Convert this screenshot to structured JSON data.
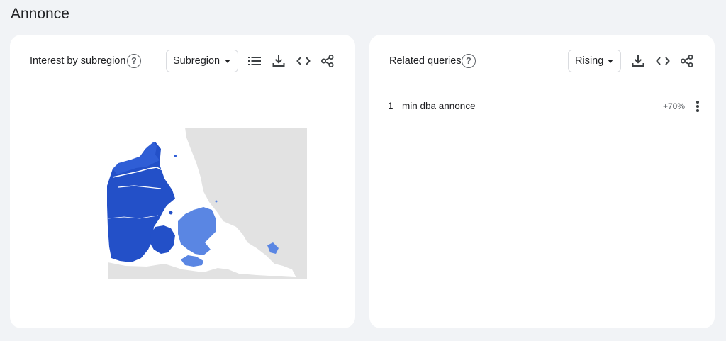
{
  "page": {
    "title": "Annonce"
  },
  "subregion_card": {
    "title": "Interest by subregion",
    "help_icon": "help-circle-icon",
    "resolution_select": {
      "selected": "Subregion"
    },
    "tools": [
      "list-icon",
      "download-icon",
      "embed-code-icon",
      "share-icon"
    ],
    "map": {
      "country": "Denmark",
      "colors": {
        "high": "#2350c8",
        "mid": "#2f5ed6",
        "low": "#5a86e3",
        "no_data": "#e2e2e2",
        "water": "#ffffff"
      }
    }
  },
  "queries_card": {
    "title": "Related queries",
    "help_icon": "help-circle-icon",
    "filter_select": {
      "selected": "Rising"
    },
    "tools": [
      "download-icon",
      "embed-code-icon",
      "share-icon"
    ],
    "rows": [
      {
        "rank": "1",
        "query": "min dba annonce",
        "value": "+70%"
      }
    ]
  }
}
